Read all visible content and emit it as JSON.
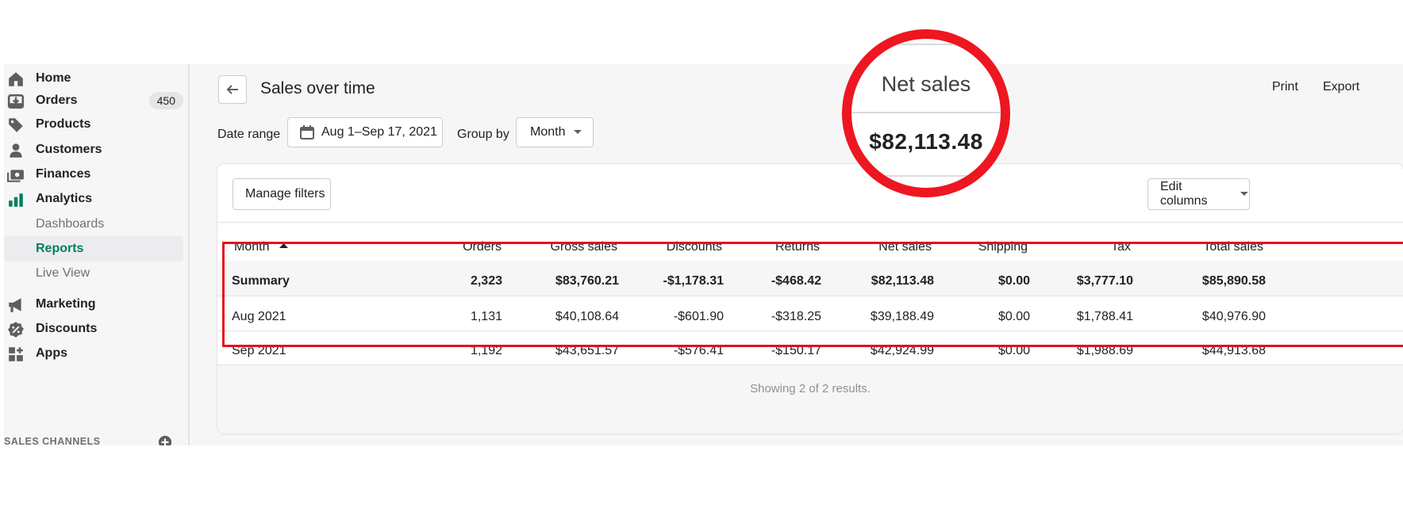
{
  "sidebar": {
    "items": [
      {
        "label": "Home",
        "icon": "home-icon"
      },
      {
        "label": "Orders",
        "icon": "orders-icon",
        "badge": "450"
      },
      {
        "label": "Products",
        "icon": "tag-icon"
      },
      {
        "label": "Customers",
        "icon": "person-icon"
      },
      {
        "label": "Finances",
        "icon": "finances-icon"
      },
      {
        "label": "Analytics",
        "icon": "bar-chart-icon"
      }
    ],
    "analytics_sub": [
      {
        "label": "Dashboards"
      },
      {
        "label": "Reports"
      },
      {
        "label": "Live View"
      }
    ],
    "items2": [
      {
        "label": "Marketing",
        "icon": "megaphone-icon"
      },
      {
        "label": "Discounts",
        "icon": "discount-icon"
      },
      {
        "label": "Apps",
        "icon": "apps-icon"
      }
    ],
    "section_label": "SALES CHANNELS"
  },
  "header": {
    "title": "Sales over time",
    "print": "Print",
    "export": "Export"
  },
  "filters": {
    "date_range_label": "Date range",
    "date_range_value": "Aug 1–Sep 17, 2021",
    "group_by_label": "Group by",
    "group_by_value": "Month"
  },
  "card": {
    "manage_filters": "Manage filters",
    "edit_columns": "Edit columns",
    "footer": "Showing 2 of 2 results."
  },
  "table": {
    "columns": [
      "Month",
      "Orders",
      "Gross sales",
      "Discounts",
      "Returns",
      "Net sales",
      "Shipping",
      "Tax",
      "Total sales"
    ],
    "summary": [
      "Summary",
      "2,323",
      "$83,760.21",
      "-$1,178.31",
      "-$468.42",
      "$82,113.48",
      "$0.00",
      "$3,777.10",
      "$85,890.58"
    ],
    "rows": [
      [
        "Aug 2021",
        "1,131",
        "$40,108.64",
        "-$601.90",
        "-$318.25",
        "$39,188.49",
        "$0.00",
        "$1,788.41",
        "$40,976.90"
      ],
      [
        "Sep 2021",
        "1,192",
        "$43,651.57",
        "-$576.41",
        "-$150.17",
        "$42,924.99",
        "$0.00",
        "$1,988.69",
        "$44,913.68"
      ]
    ]
  },
  "zoom": {
    "heading": "Net sales",
    "value": "$82,113.48"
  },
  "colors": {
    "accent_green": "#007f5f",
    "highlight_red": "#e3121b"
  }
}
